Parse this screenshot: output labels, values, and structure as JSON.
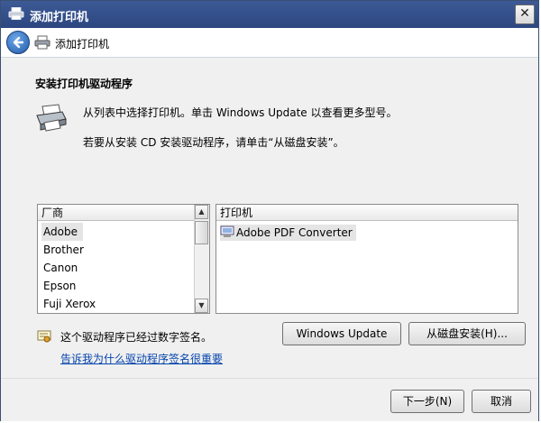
{
  "window": {
    "title": "添加打印机",
    "close_label": "✕"
  },
  "nav": {
    "title": "添加打印机"
  },
  "content": {
    "heading": "安装打印机驱动程序",
    "instruction1": "从列表中选择打印机。单击 Windows Update 以查看更多型号。",
    "instruction2": "若要从安装 CD 安装驱动程序，请单击“从磁盘安装”。"
  },
  "manufacturer_list": {
    "header": "厂商",
    "items": [
      "Adobe",
      "Brother",
      "Canon",
      "Epson",
      "Fuji Xerox"
    ],
    "selected": "Adobe"
  },
  "printer_list": {
    "header": "打印机",
    "items": [
      "Adobe PDF Converter"
    ]
  },
  "signature": {
    "status": "这个驱动程序已经过数字签名。",
    "link": "告诉我为什么驱动程序签名很重要"
  },
  "buttons": {
    "windows_update": "Windows Update",
    "from_disk": "从磁盘安装(H)...",
    "next": "下一步(N)",
    "cancel": "取消"
  }
}
